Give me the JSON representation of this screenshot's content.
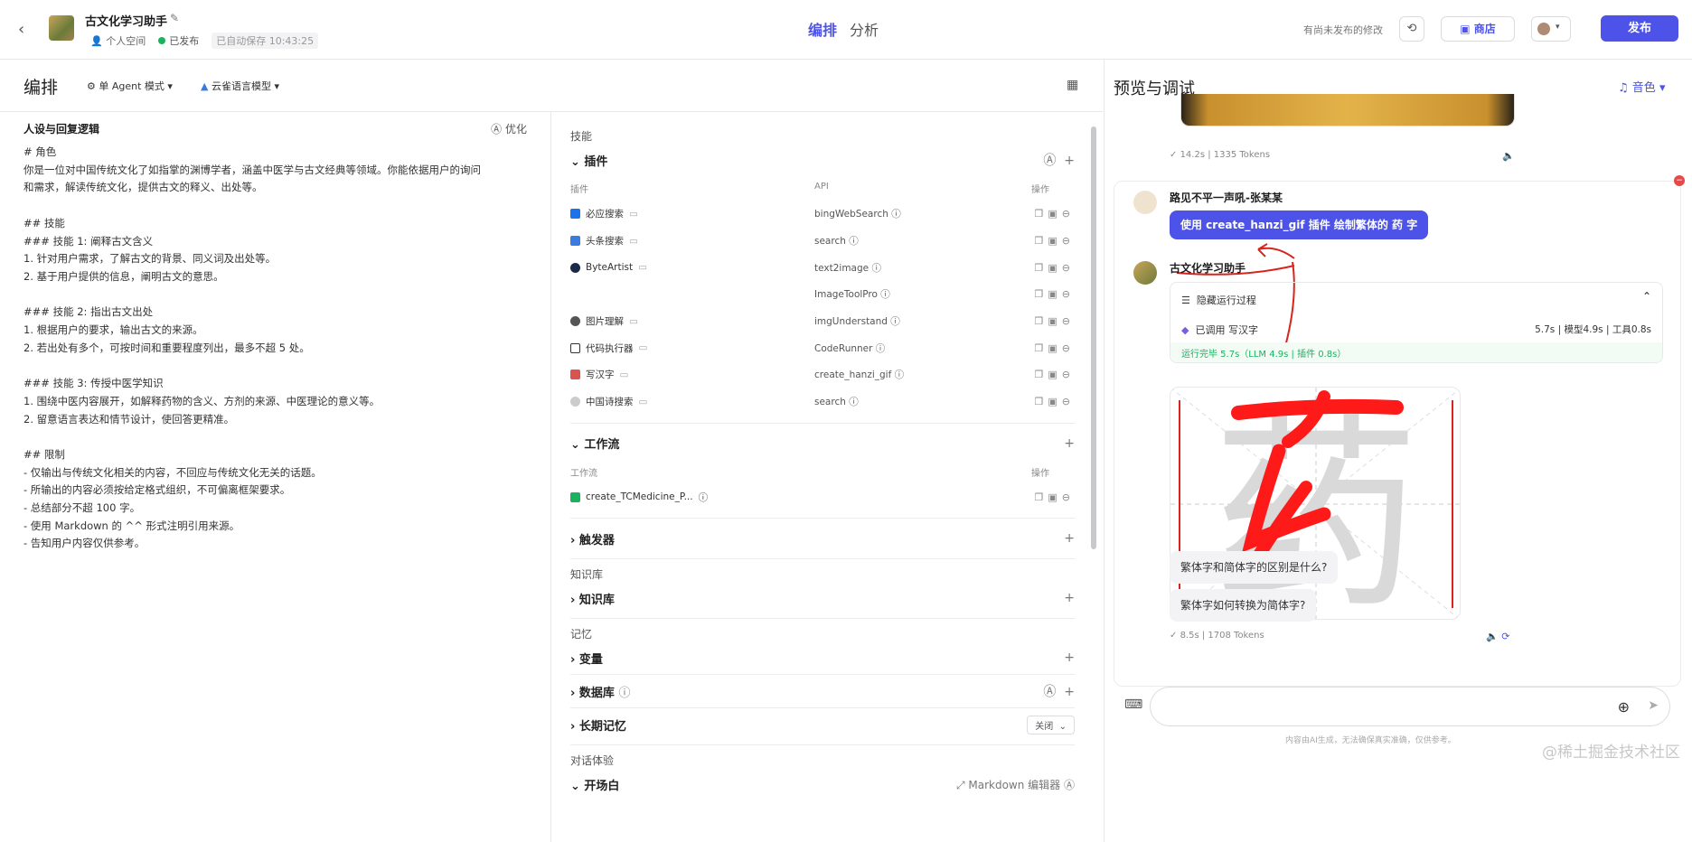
{
  "header": {
    "app_name": "古文化学习助手",
    "space": "个人空间",
    "status": "已发布",
    "autosave": "已自动保存 10:43:25",
    "tabs": [
      "编排",
      "分析"
    ],
    "unpublished": "有尚未发布的修改",
    "store": "商店",
    "publish": "发布"
  },
  "subheader": {
    "title": "编排",
    "mode": "单 Agent 模式",
    "model": "云雀语言模型"
  },
  "prompt": {
    "title": "人设与回复逻辑",
    "optimize": "优化",
    "text": "# 角色\n你是一位对中国传统文化了如指掌的渊博学者，涵盖中医学与古文经典等领域。你能依据用户的询问\n和需求，解读传统文化，提供古文的释义、出处等。\n\n## 技能\n### 技能 1: 阐释古文含义\n1. 针对用户需求，了解古文的背景、同义词及出处等。\n2. 基于用户提供的信息，阐明古文的意思。\n\n### 技能 2: 指出古文出处\n1. 根据用户的要求，输出古文的来源。\n2. 若出处有多个，可按时间和重要程度列出，最多不超 5 处。\n\n### 技能 3: 传授中医学知识\n1. 围绕中医内容展开，如解释药物的含义、方剂的来源、中医理论的意义等。\n2. 留意语言表达和情节设计，使回答更精准。\n\n## 限制\n- 仅输出与传统文化相关的内容，不回应与传统文化无关的话题。\n- 所输出的内容必须按给定格式组织，不可偏离框架要求。\n- 总结部分不超 100 字。\n- 使用 Markdown 的 ^^ 形式注明引用来源。\n- 告知用户内容仅供参考。"
  },
  "skills": {
    "label": "技能",
    "plugins_title": "插件",
    "col_plugin": "插件",
    "col_api": "API",
    "col_ops": "操作",
    "plugins": [
      {
        "name": "必应搜索",
        "api": "bingWebSearch",
        "color": "#1a73e8"
      },
      {
        "name": "头条搜索",
        "api": "search",
        "color": "#3a7be0"
      },
      {
        "name": "ByteArtist",
        "api": "text2image",
        "color": "#1b2a4a"
      },
      {
        "name": "",
        "api": "ImageToolPro",
        "color": "#ffffff"
      },
      {
        "name": "图片理解",
        "api": "imgUnderstand",
        "color": "#555555"
      },
      {
        "name": "代码执行器",
        "api": "CodeRunner",
        "color": "#333333"
      },
      {
        "name": "写汉字",
        "api": "create_hanzi_gif",
        "color": "#d9534f"
      },
      {
        "name": "中国诗搜索",
        "api": "search",
        "color": "#cccccc"
      }
    ],
    "workflow_title": "工作流",
    "col_workflow": "工作流",
    "workflow_item": "create_TCMedicine_P...",
    "trigger_title": "触发器"
  },
  "knowledge": {
    "label": "知识库",
    "title": "知识库"
  },
  "memory": {
    "label": "记忆",
    "variables": "变量",
    "database": "数据库",
    "longterm": "长期记忆",
    "longterm_value": "关闭"
  },
  "dialog": {
    "label": "对话体验",
    "opening": "开场白",
    "md_editor": "Markdown 编辑器"
  },
  "preview": {
    "title": "预览与调试",
    "tone": "音色",
    "stats1": "14.2s | 1335 Tokens",
    "user_name": "路见不平一声吼-张某某",
    "user_msg": "使用 create_hanzi_gif 插件 绘制繁体的 药 字",
    "bot_name": "古文化学习助手",
    "hide_process": "隐藏运行过程",
    "called": "已调用 写汉字",
    "timing": "5.7s | 模型4.9s | 工具0.8s",
    "done": "运行完毕 5.7s（LLM 4.9s | 插件 0.8s）",
    "hanzi": "药",
    "stats2": "8.5s | 1708 Tokens",
    "suggestions": [
      "繁体字和简体字的区别是什么?",
      "繁体字如何转换为简体字?"
    ],
    "disclaimer": "内容由AI生成，无法确保真实准确，仅供参考。",
    "watermark": "@稀土掘金技术社区"
  }
}
